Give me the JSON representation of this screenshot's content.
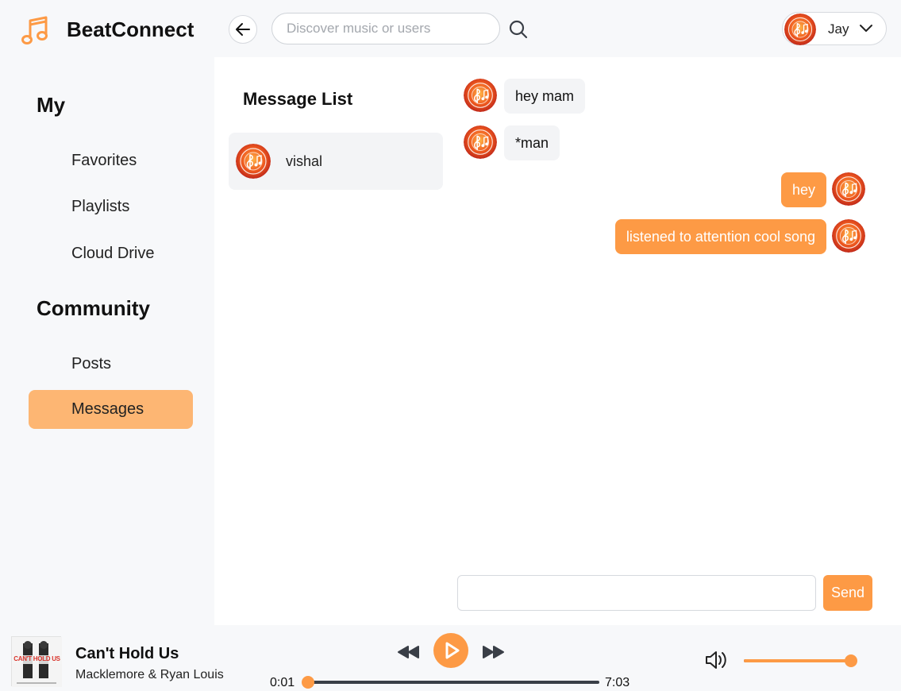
{
  "header": {
    "brand": "BeatConnect",
    "search_placeholder": "Discover music or users",
    "user_name": "Jay"
  },
  "sidebar": {
    "section_my": "My",
    "my_items": [
      {
        "label": "Favorites"
      },
      {
        "label": "Playlists"
      },
      {
        "label": "Cloud Drive"
      }
    ],
    "section_community": "Community",
    "community_items": [
      {
        "label": "Posts"
      },
      {
        "label": "Messages",
        "active": true
      }
    ]
  },
  "messages": {
    "list_title": "Message List",
    "conversations": [
      {
        "name": "vishal"
      }
    ],
    "thread": [
      {
        "text": "hey mam",
        "direction": "in"
      },
      {
        "text": "*man",
        "direction": "in"
      },
      {
        "text": "hey",
        "direction": "out"
      },
      {
        "text": "listened to attention cool song",
        "direction": "out"
      }
    ],
    "composer_value": "",
    "send_label": "Send"
  },
  "player": {
    "track_title": "Can't Hold Us",
    "track_artist": "Macklemore & Ryan Louis",
    "album_art_text": "CAN'T HOLD US",
    "current_time": "0:01",
    "total_time": "7:03",
    "progress_fraction": 0.002,
    "volume_fraction": 1.0
  },
  "colors": {
    "accent": "#fd9a45",
    "active_nav": "#fdb673",
    "incoming_bubble": "#f3f4f6"
  },
  "icons": {
    "logo": "music-note-icon",
    "back": "arrow-left-icon",
    "search": "search-icon",
    "menu": "chevron-down-icon",
    "prev": "rewind-icon",
    "play": "play-icon",
    "next": "fast-forward-icon",
    "volume": "volume-icon"
  }
}
